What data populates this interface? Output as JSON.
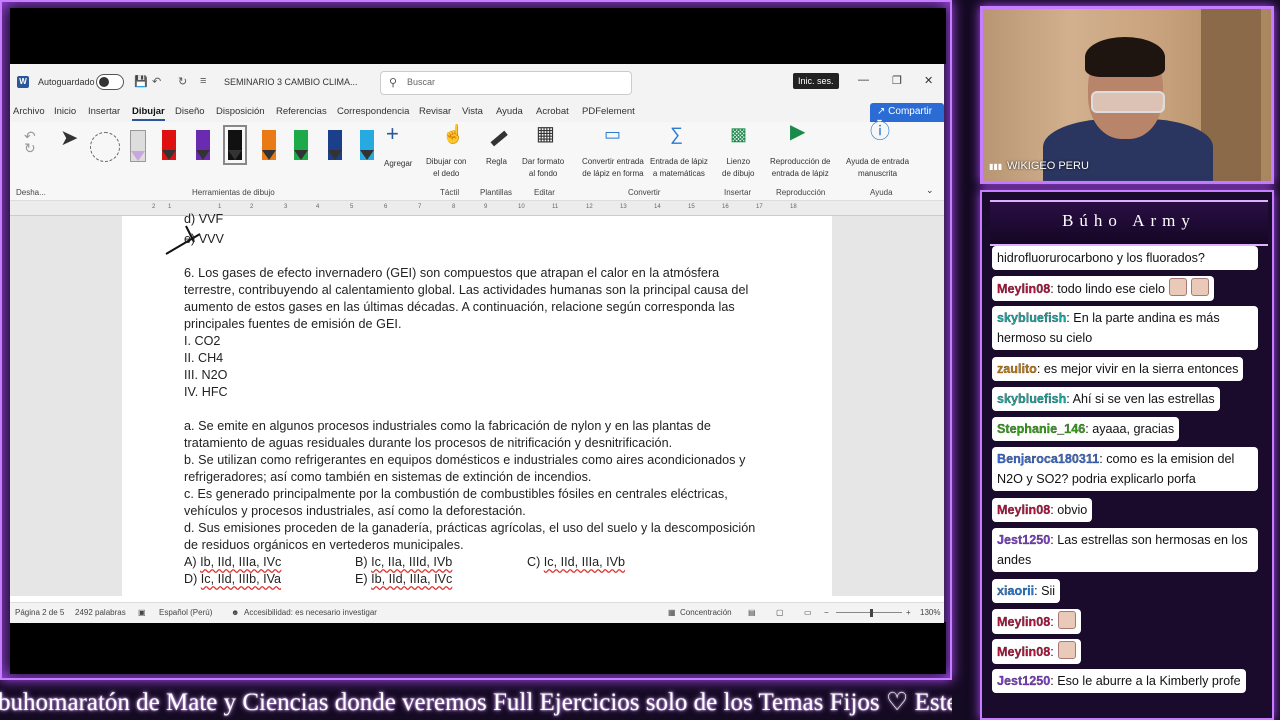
{
  "word": {
    "autosave_label": "Autoguardado",
    "doc_name": "SEMINARIO 3 CAMBIO CLIMA...",
    "search_placeholder": "Buscar",
    "signin": "Inic. ses.",
    "tabs": [
      "Archivo",
      "Inicio",
      "Insertar",
      "Dibujar",
      "Diseño",
      "Disposición",
      "Referencias",
      "Correspondencia",
      "Revisar",
      "Vista",
      "Ayuda",
      "Acrobat",
      "PDFelement"
    ],
    "share": "Compartir",
    "ribbon": {
      "undo_group": "Desha...",
      "tools_group": "Herramientas de dibujo",
      "add": "Agregar",
      "draw_finger": [
        "Dibujar con",
        "el dedo"
      ],
      "ruler": "Regla",
      "bg": [
        "Dar formato",
        "al fondo"
      ],
      "convert_shape": [
        "Convertir entrada",
        "de lápiz en forma"
      ],
      "math": [
        "Entrada de lápiz",
        "a matemáticas"
      ],
      "canvas": [
        "Lienzo",
        "de dibujo"
      ],
      "replay": [
        "Reproducción de",
        "entrada de lápiz"
      ],
      "help_ink": [
        "Ayuda de entrada",
        "manuscrita"
      ],
      "groups": [
        "Táctil",
        "Plantillas",
        "Editar",
        "Convertir",
        "Insertar",
        "Reproducción",
        "Ayuda"
      ]
    },
    "ruler_ticks": [
      "2",
      "1",
      "1",
      "2",
      "3",
      "4",
      "5",
      "6",
      "7",
      "8",
      "9",
      "10",
      "11",
      "12",
      "13",
      "14",
      "15",
      "16",
      "17",
      "18"
    ],
    "document": {
      "prev_option_d": "d) VVF",
      "prev_option_e": "e) VVV",
      "question_lines": [
        "6. Los gases de efecto invernadero (GEI) son compuestos que atrapan el calor en la atmósfera",
        "terrestre, contribuyendo al calentamiento global. Las actividades humanas son la principal causa del",
        "aumento de estos gases en las últimas décadas. A continuación, relacione según corresponda las",
        "principales fuentes de emisión de GEI."
      ],
      "gases": [
        "I. CO2",
        "II. CH4",
        "III. N2O",
        "IV. HFC"
      ],
      "statements": [
        "a. Se emite en algunos procesos industriales como la fabricación de nylon y en las plantas de",
        "tratamiento de aguas residuales durante los procesos de nitrificación y desnitrificación.",
        "b. Se utilizan como refrigerantes en equipos domésticos e industriales como aires acondicionados y",
        "refrigeradores; así como también en sistemas de extinción de incendios.",
        "c. Es generado principalmente por la combustión de combustibles fósiles en centrales eléctricas,",
        "vehículos y procesos industriales, así como la deforestación.",
        "d. Sus emisiones proceden de la ganadería, prácticas agrícolas, el uso del suelo y la descomposición",
        "de residuos orgánicos en vertederos municipales."
      ],
      "answers": {
        "A": {
          "letter": "A) ",
          "text": "Ib, IId, IIIa, IVc"
        },
        "B": {
          "letter": "B) ",
          "text": "Ic, IIa, IIId, IVb"
        },
        "C": {
          "letter": "C) ",
          "text": "Ic, IId, IIIa, IVb"
        },
        "D": {
          "letter": "D) ",
          "text": "Ic, IId, IIIb, IVa"
        },
        "E": {
          "letter": "E) ",
          "text": "Ib, IId, IIIa, IVc"
        }
      }
    },
    "status": {
      "page": "Página 2 de 5",
      "words": "2492 palabras",
      "lang": "Español (Perú)",
      "access": "Accesibilidad: es necesario investigar",
      "focus": "Concentración",
      "zoom": "130%"
    }
  },
  "ticker": "buhomaratón de Mate y Ciencias donde veremos Full Ejercicios solo de los Temas Fijos ♡  Este I",
  "cam": {
    "label": "WIKIGEO PERU"
  },
  "chat": {
    "title": "Búho Army",
    "messages": [
      {
        "name": "",
        "text": "hidrofluorurocarbono y los fluorados?",
        "color": "#111111"
      },
      {
        "name": "Meylin08",
        "text": ": todo lindo ese cielo",
        "color": "#b0153c"
      },
      {
        "name": "skybluefish",
        "text": ": En la parte andina es más hermoso su cielo",
        "color": "#1aa7a0"
      },
      {
        "name": "zaulito",
        "text": ": es mejor vivir en la sierra entonces",
        "color": "#c07a12"
      },
      {
        "name": "skybluefish",
        "text": ": Ahí si se ven las estrellas",
        "color": "#1aa7a0"
      },
      {
        "name": "Stephanie_146",
        "text": ": ayaaa, gracias",
        "color": "#37a11a"
      },
      {
        "name": "Benjaroca180311",
        "text": ": como es la emision del N2O y SO2? podria explicarlo porfa",
        "color": "#3a6ad0"
      },
      {
        "name": "Meylin08",
        "text": ": obvio",
        "color": "#b0153c"
      },
      {
        "name": "Jest1250",
        "text": ": Las estrellas son hermosas en los andes",
        "color": "#7b3fc4"
      },
      {
        "name": "xiaorii",
        "text": ": Sii",
        "color": "#2a7bd0"
      },
      {
        "name": "Meylin08",
        "text": ":",
        "color": "#b0153c"
      },
      {
        "name": "Meylin08",
        "text": ":",
        "color": "#b0153c"
      },
      {
        "name": "Jest1250",
        "text": ": Eso le aburre a la Kimberly profe",
        "color": "#7b3fc4"
      }
    ]
  }
}
